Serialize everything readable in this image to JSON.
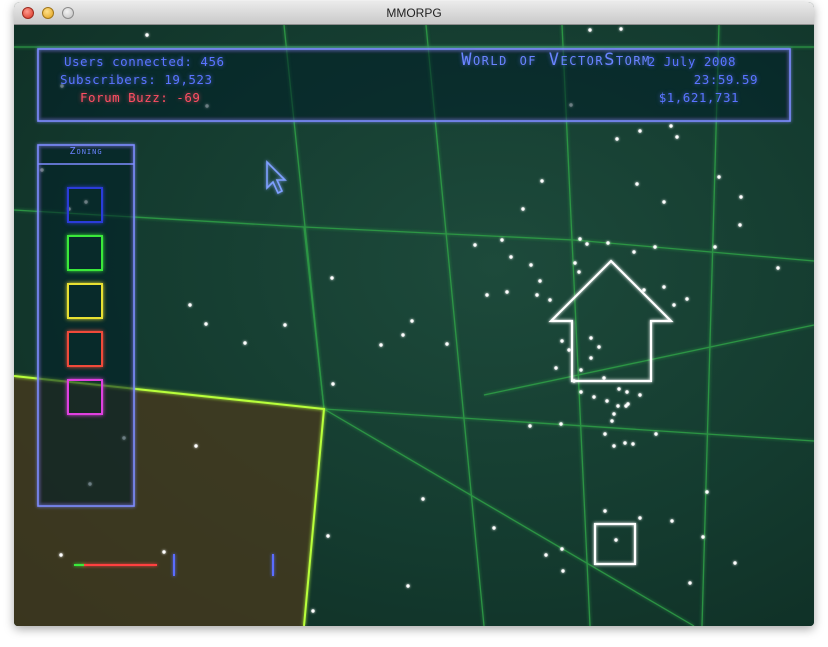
{
  "window": {
    "title": "MMORPG"
  },
  "hud": {
    "users_connected": "Users connected: 456",
    "subscribers": "Subscribers: 19,523",
    "forum_buzz": "Forum Buzz: -69",
    "game_title": "World of VectorStorm",
    "date": "2 July 2008",
    "time": "23:59.59",
    "money": "$1,621,731"
  },
  "zoning": {
    "label": "Zoning",
    "swatches": [
      {
        "name": "blue",
        "color": "#2a3cd8"
      },
      {
        "name": "green",
        "color": "#3ae83a"
      },
      {
        "name": "yellow",
        "color": "#e8e032"
      },
      {
        "name": "red",
        "color": "#f04a3a"
      },
      {
        "name": "magenta",
        "color": "#e040e0"
      }
    ]
  },
  "icons": {
    "cursor": "arrow-cursor-icon",
    "building": "house-arrow-icon",
    "selection": "square-selection-icon"
  },
  "colors": {
    "hud_blue": "#5a74ff",
    "hud_red": "#ff4e63",
    "grid_green": "#2aa84a",
    "zone_boundary": "#b8ff3a",
    "zone_fill": "#5a4020"
  }
}
